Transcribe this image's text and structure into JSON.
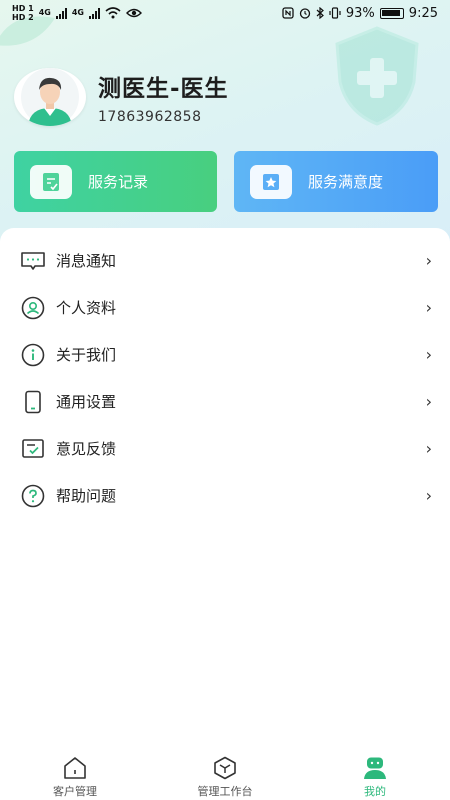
{
  "status_bar": {
    "sim1": "HD 1",
    "sim2": "HD 2",
    "net1": "4G",
    "net2": "4G",
    "battery": "93%",
    "time": "9:25"
  },
  "profile": {
    "name": "测医生-医生",
    "phone": "17863962858"
  },
  "cards": [
    {
      "label": "服务记录",
      "icon": "record-icon"
    },
    {
      "label": "服务满意度",
      "icon": "satisfaction-icon"
    }
  ],
  "menu": [
    {
      "label": "消息通知",
      "icon": "message-icon"
    },
    {
      "label": "个人资料",
      "icon": "profile-icon"
    },
    {
      "label": "关于我们",
      "icon": "info-icon"
    },
    {
      "label": "通用设置",
      "icon": "phone-settings-icon"
    },
    {
      "label": "意见反馈",
      "icon": "feedback-icon"
    },
    {
      "label": "帮助问题",
      "icon": "help-icon"
    }
  ],
  "tabs": [
    {
      "label": "客户管理",
      "icon": "home-icon",
      "active": false
    },
    {
      "label": "管理工作台",
      "icon": "workbench-icon",
      "active": false
    },
    {
      "label": "我的",
      "icon": "mine-icon",
      "active": true
    }
  ],
  "colors": {
    "accent_green": "#2db87c",
    "card_green": "#48cf7f",
    "card_blue": "#4a9df7"
  }
}
